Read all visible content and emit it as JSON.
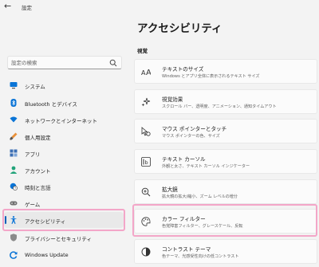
{
  "window": {
    "back_glyph": "←",
    "title": "設定"
  },
  "search": {
    "placeholder": "設定の検索"
  },
  "sidebar": {
    "items": [
      {
        "label": "システム",
        "icon": "monitor-icon"
      },
      {
        "label": "Bluetooth とデバイス",
        "icon": "bluetooth-icon"
      },
      {
        "label": "ネットワークとインターネット",
        "icon": "wifi-icon"
      },
      {
        "label": "個人用設定",
        "icon": "brush-icon"
      },
      {
        "label": "アプリ",
        "icon": "apps-icon"
      },
      {
        "label": "アカウント",
        "icon": "person-icon"
      },
      {
        "label": "時刻と言語",
        "icon": "globe-clock-icon"
      },
      {
        "label": "ゲーム",
        "icon": "gamepad-icon"
      },
      {
        "label": "アクセシビリティ",
        "icon": "accessibility-icon",
        "selected": true
      },
      {
        "label": "プライバシーとセキュリティ",
        "icon": "shield-icon"
      },
      {
        "label": "Windows Update",
        "icon": "update-icon"
      }
    ]
  },
  "main": {
    "title": "アクセシビリティ",
    "section": "視覚",
    "cards": [
      {
        "title": "テキストのサイズ",
        "subtitle": "Windows とアプリ全体に表示されるテキスト サイズ",
        "icon": "text-size-icon"
      },
      {
        "title": "視覚効果",
        "subtitle": "スクロール バー、透明度、アニメーション、通知タイムアウト",
        "icon": "sparkle-icon"
      },
      {
        "title": "マウス ポインターとタッチ",
        "subtitle": "マウス ポインターの色、サイズ",
        "icon": "pointer-icon"
      },
      {
        "title": "テキスト カーソル",
        "subtitle": "外観と太さ、テキスト カーソル インジケーター",
        "icon": "text-cursor-icon"
      },
      {
        "title": "拡大鏡",
        "subtitle": "拡大鏡の拡大/縮小、ズーム レベルの増分",
        "icon": "magnifier-icon"
      },
      {
        "title": "カラー フィルター",
        "subtitle": "色覚障害フィルター、グレースケール、反転",
        "icon": "palette-icon"
      },
      {
        "title": "コントラスト テーマ",
        "subtitle": "色テーマ、光感受性向けの低コントラスト",
        "icon": "contrast-icon"
      }
    ]
  },
  "colors": {
    "accent": "#005fb8",
    "highlight_border": "#f3a6c8",
    "background": "#f3f3f3",
    "card": "#fbfbfb"
  }
}
